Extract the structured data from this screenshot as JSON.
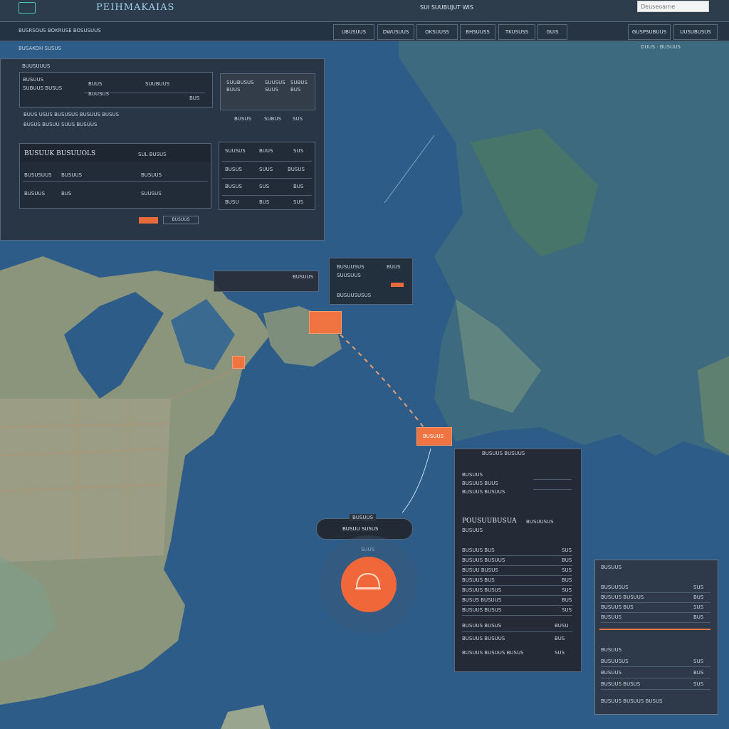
{
  "app": {
    "title": "PEIHMAKAIAS",
    "status_text": "SUI SUUBUJUT WIS"
  },
  "search": {
    "placeholder": "Deuseoarne"
  },
  "subbar": {
    "breadcrumb": "BUSRSOUS BOKRUSE BOSUSUUS",
    "tabs": [
      "UBUSUUS",
      "DWUSUUS",
      "OKSUUSS",
      "BHSUUSS",
      "TKUSUSS",
      "GUIS",
      "GUSPSUBUUS",
      "UUSUBUSUS"
    ]
  },
  "subline": {
    "left": "BUSAKOH SUSUS",
    "right": "DUUS · BUSUUS"
  },
  "summary": {
    "heading": "BUUSUUUS",
    "card_a": {
      "l1": "BUSUUS",
      "l2": "SUBUUS BUSUS",
      "l3": "BUUS",
      "l4": "SUUBUUS",
      "l5": "BUUSUS",
      "l6": "BUS"
    },
    "card_b": {
      "c1": "SUUBUSUS",
      "c2": "SUUSUS",
      "c3": "SUBUS",
      "c4": "BUUS",
      "c5": "SUUS",
      "c6": "BUS",
      "c7": "BUSUS",
      "c8": "SUBUS",
      "c9": "SUS"
    },
    "line_a": "BUUS USUS  BUSUSUS  BUSUUS BUSUS",
    "line_b": "BUSUS BUSUU  SUUS  BUSUUS"
  },
  "routes": {
    "title": "BUSUUK BUSUUOLS",
    "col2": "SUL BUSUS",
    "r1a": "BUSUSUUS",
    "r1b": "BUSUUS",
    "r1c": "BUSUUS",
    "r2a": "BUSUUS",
    "r2b": "BUS",
    "r2c": "SUUSUS",
    "btn": "BUSUUS"
  },
  "grid": {
    "h1": "SUUSUS",
    "h2": "BUUS",
    "h3": "SUS",
    "r1": [
      "BUSUS",
      "SUUS",
      "BUSUS"
    ],
    "r2": [
      "BUSUS",
      "SUS",
      "BUS"
    ],
    "r3": [
      "BUSU",
      "BUS",
      "SUS"
    ]
  },
  "callout1": {
    "t1": "BUSUUSUS",
    "t2": "BUUS",
    "t3": "SUUSUUS",
    "t4": "BUSUUSUSUS"
  },
  "bar_callout": {
    "t1": "BUSUUS"
  },
  "marker2": {
    "t1": "BUSUUS"
  },
  "dock": {
    "label": "BUSUUS",
    "title": "BUSUU SUSUS",
    "mini": "SUUS"
  },
  "detail": {
    "header": "BUSUUS BUSUUS",
    "f1": "BUSUUS",
    "f2": "BUSUUS BUUS",
    "f3": "BUSUUS BUSUUS",
    "sec_a": "POUSUUBUSUA",
    "sec_b": "BUSUUSUS",
    "sub": "BUSUUS",
    "rows": [
      {
        "k": "BUSUUS BUS",
        "v": "SUS"
      },
      {
        "k": "BUSUUS BUSUUS",
        "v": "BUS"
      },
      {
        "k": "BUSUU BUSUS",
        "v": "SUS"
      },
      {
        "k": "BUSUUS BUS",
        "v": "BUS"
      },
      {
        "k": "BUSUUS BUSUS",
        "v": "SUS"
      },
      {
        "k": "BUSUS BUSUUS",
        "v": "BUS"
      },
      {
        "k": "BUSUUS BUSUS",
        "v": "SUS"
      }
    ],
    "foot1": "BUSUUS BUSUS",
    "foot1v": "BUSU",
    "foot2": "BUSUUS BUSUUS",
    "foot2v": "BUS",
    "foot3": "BUSUUS BUSUUS BUSUS",
    "foot3v": "SUS"
  },
  "side": {
    "title": "BUSUUS",
    "rows": [
      {
        "k": "BUSUUSUS",
        "v": "SUS"
      },
      {
        "k": "BUSUUS BUSUUS",
        "v": "BUS"
      },
      {
        "k": "BUSUUS BUS",
        "v": "SUS"
      },
      {
        "k": "BUSUUS",
        "v": "BUS"
      }
    ],
    "sec": "BUSUUS",
    "rows2": [
      {
        "k": "BUSUUSUS",
        "v": "SUS"
      },
      {
        "k": "BUSUUS",
        "v": "BUS"
      },
      {
        "k": "BUSUUS BUSUS",
        "v": "SUS"
      }
    ],
    "foot": "BUSUUS BUSUUS BUSUS"
  },
  "colors": {
    "accent": "#f0683a",
    "panel": "#242c38",
    "ocean": "#2d5b86"
  }
}
